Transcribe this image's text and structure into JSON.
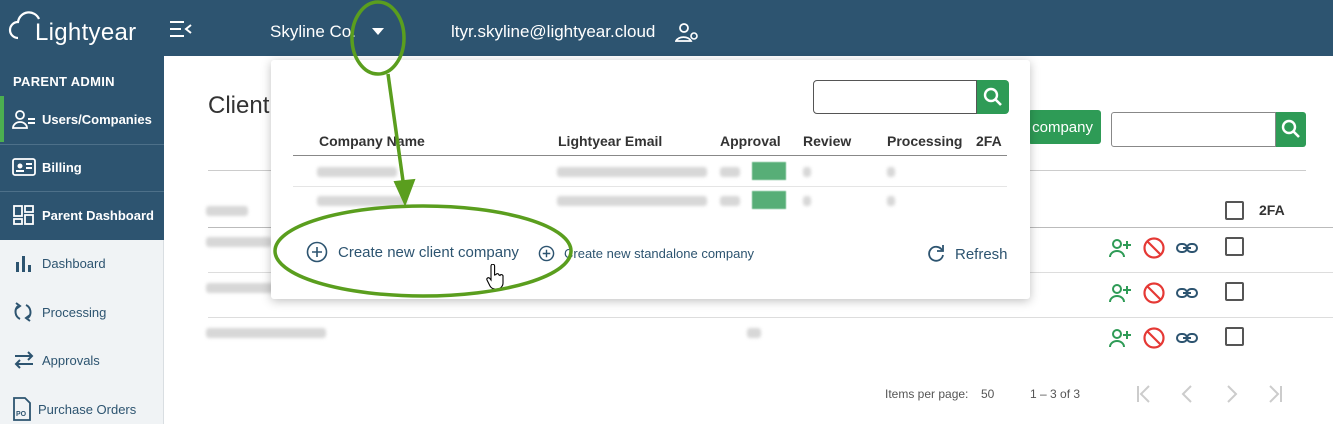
{
  "app": {
    "logo_text": "Lightyear"
  },
  "header": {
    "company": "Skyline Co.",
    "user_email": "ltyr.skyline@lightyear.cloud"
  },
  "sidebar": {
    "heading": "PARENT ADMIN",
    "items": [
      {
        "label": "Users/Companies",
        "icon": "users-icon",
        "active": true
      },
      {
        "label": "Billing",
        "icon": "id-card-icon"
      },
      {
        "label": "Parent Dashboard",
        "icon": "grid-icon"
      },
      {
        "label": "Dashboard",
        "icon": "bar-chart-icon"
      },
      {
        "label": "Processing",
        "icon": "sync-icon"
      },
      {
        "label": "Approvals",
        "icon": "swap-icon"
      },
      {
        "label": "Purchase Orders",
        "icon": "po-document-icon"
      }
    ]
  },
  "main": {
    "title": "Client",
    "add_button": "company",
    "column_2fa": "2FA",
    "pagination": {
      "items_per_page_label": "Items per page:",
      "items_per_page": "50",
      "range": "1 – 3 of 3"
    }
  },
  "dropdown": {
    "columns": [
      "Company Name",
      "Lightyear Email",
      "Approval",
      "Review",
      "Processing",
      "2FA"
    ],
    "create_client": "Create new client company",
    "create_standalone": "Create new standalone company",
    "refresh": "Refresh"
  },
  "colors": {
    "header_bg": "#2d5470",
    "accent_green": "#2e9b56",
    "danger_red": "#e53935",
    "annotation_green": "#5a9e1e"
  }
}
